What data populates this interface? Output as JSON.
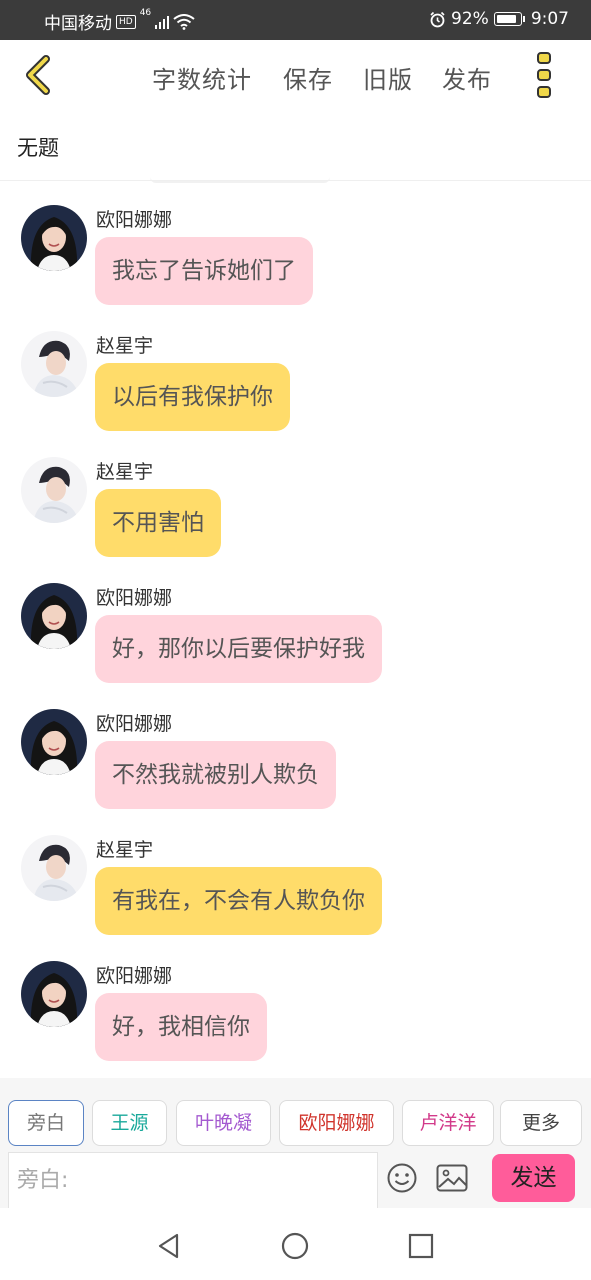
{
  "status_bar": {
    "carrier": "中国移动",
    "hd_badge": "HD",
    "network": "46",
    "battery_percent": "92%",
    "battery_level": 0.92,
    "time": "9:07"
  },
  "header": {
    "back_icon": "chevron-left-icon",
    "word_count_label": "字数统计",
    "save_label": "保存",
    "old_version_label": "旧版",
    "publish_label": "发布",
    "more_icon": "vertical-dots-icon",
    "accent_color": "#f0d84a"
  },
  "document": {
    "title": "无题"
  },
  "messages": [
    {
      "sender": "欧阳娜娜",
      "text": "我忘了告诉她们了",
      "bubble_color": "#ffd4dc",
      "avatar": "female-avatar"
    },
    {
      "sender": "赵星宇",
      "text": "以后有我保护你",
      "bubble_color": "#ffdc6a",
      "avatar": "male-avatar"
    },
    {
      "sender": "赵星宇",
      "text": "不用害怕",
      "bubble_color": "#ffdc6a",
      "avatar": "male-avatar"
    },
    {
      "sender": "欧阳娜娜",
      "text": "好，那你以后要保护好我",
      "bubble_color": "#ffd4dc",
      "avatar": "female-avatar"
    },
    {
      "sender": "欧阳娜娜",
      "text": "不然我就被别人欺负",
      "bubble_color": "#ffd4dc",
      "avatar": "female-avatar"
    },
    {
      "sender": "赵星宇",
      "text": "有我在，不会有人欺负你",
      "bubble_color": "#ffdc6a",
      "avatar": "male-avatar"
    },
    {
      "sender": "欧阳娜娜",
      "text": "好，我相信你",
      "bubble_color": "#ffd4dc",
      "avatar": "female-avatar"
    }
  ],
  "role_chips": [
    {
      "label": "旁白",
      "color": "#777777",
      "selected": true
    },
    {
      "label": "王源",
      "color": "#1aa99b",
      "selected": false
    },
    {
      "label": "叶晚凝",
      "color": "#a45ad0",
      "selected": false
    },
    {
      "label": "欧阳娜娜",
      "color": "#d0342c",
      "selected": false
    },
    {
      "label": "卢洋洋",
      "color": "#d23a8a",
      "selected": false
    },
    {
      "label": "更多",
      "color": "#444444",
      "selected": false
    }
  ],
  "composer": {
    "placeholder": "旁白:",
    "emoji_icon": "smiley-icon",
    "image_icon": "image-icon",
    "send_label": "发送",
    "send_color": "#ff5c9a"
  },
  "nav": {
    "back_icon": "triangle-back-icon",
    "home_icon": "circle-home-icon",
    "recents_icon": "square-recents-icon"
  }
}
